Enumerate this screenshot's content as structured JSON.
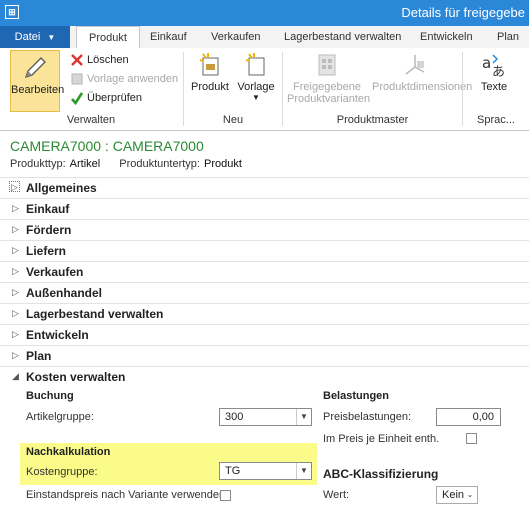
{
  "window": {
    "title": "Details für freigegebe",
    "icon": "app-window-icon"
  },
  "tabs": [
    "Datei",
    "Produkt",
    "Einkauf",
    "Verkaufen",
    "Lagerbestand verwalten",
    "Entwickeln",
    "Plan"
  ],
  "ribbon": {
    "verwalten": {
      "label": "Verwalten",
      "edit": "Bearbeiten",
      "delete": "Löschen",
      "apply_template": "Vorlage anwenden",
      "validate": "Überprüfen"
    },
    "neu": {
      "label": "Neu",
      "product": "Produkt",
      "template": "Vorlage"
    },
    "produktmaster": {
      "label": "Produktmaster",
      "released_variants_1": "Freigegebene",
      "released_variants_2": "Produktvarianten",
      "dimensions": "Produktdimensionen"
    },
    "sprache": {
      "label": "Sprac...",
      "texts": "Texte"
    }
  },
  "record": {
    "title": "CAMERA7000 : CAMERA7000",
    "type_label": "Produkttyp:",
    "type_value": "Artikel",
    "subtype_label": "Produktuntertyp:",
    "subtype_value": "Produkt"
  },
  "fasttabs": [
    "Allgemeines",
    "Einkauf",
    "Fördern",
    "Liefern",
    "Verkaufen",
    "Außenhandel",
    "Lagerbestand verwalten",
    "Entwickeln",
    "Plan",
    "Kosten verwalten"
  ],
  "kosten": {
    "buchung_label": "Buchung",
    "artikelgruppe_label": "Artikelgruppe:",
    "artikelgruppe_value": "300",
    "nachkalk_label": "Nachkalkulation",
    "kostengruppe_label": "Kostengruppe:",
    "kostengruppe_value": "TG",
    "variant_cost_label": "Einstandspreis nach Variante verwenden:",
    "belastungen_label": "Belastungen",
    "preisbelastungen_label": "Preisbelastungen:",
    "preisbelastungen_value": "0,00",
    "unit_price_label": "Im Preis je Einheit enth.",
    "abc_label": "ABC-Klassifizierung",
    "wert_label": "Wert:",
    "wert_value": "Kein"
  },
  "colors": {
    "titlebar": "#2b88d8",
    "file_tab": "#1f66b3",
    "record_title": "#2a8a33",
    "highlight": "#fbfb8a",
    "edit_button": "#fbe49a"
  }
}
